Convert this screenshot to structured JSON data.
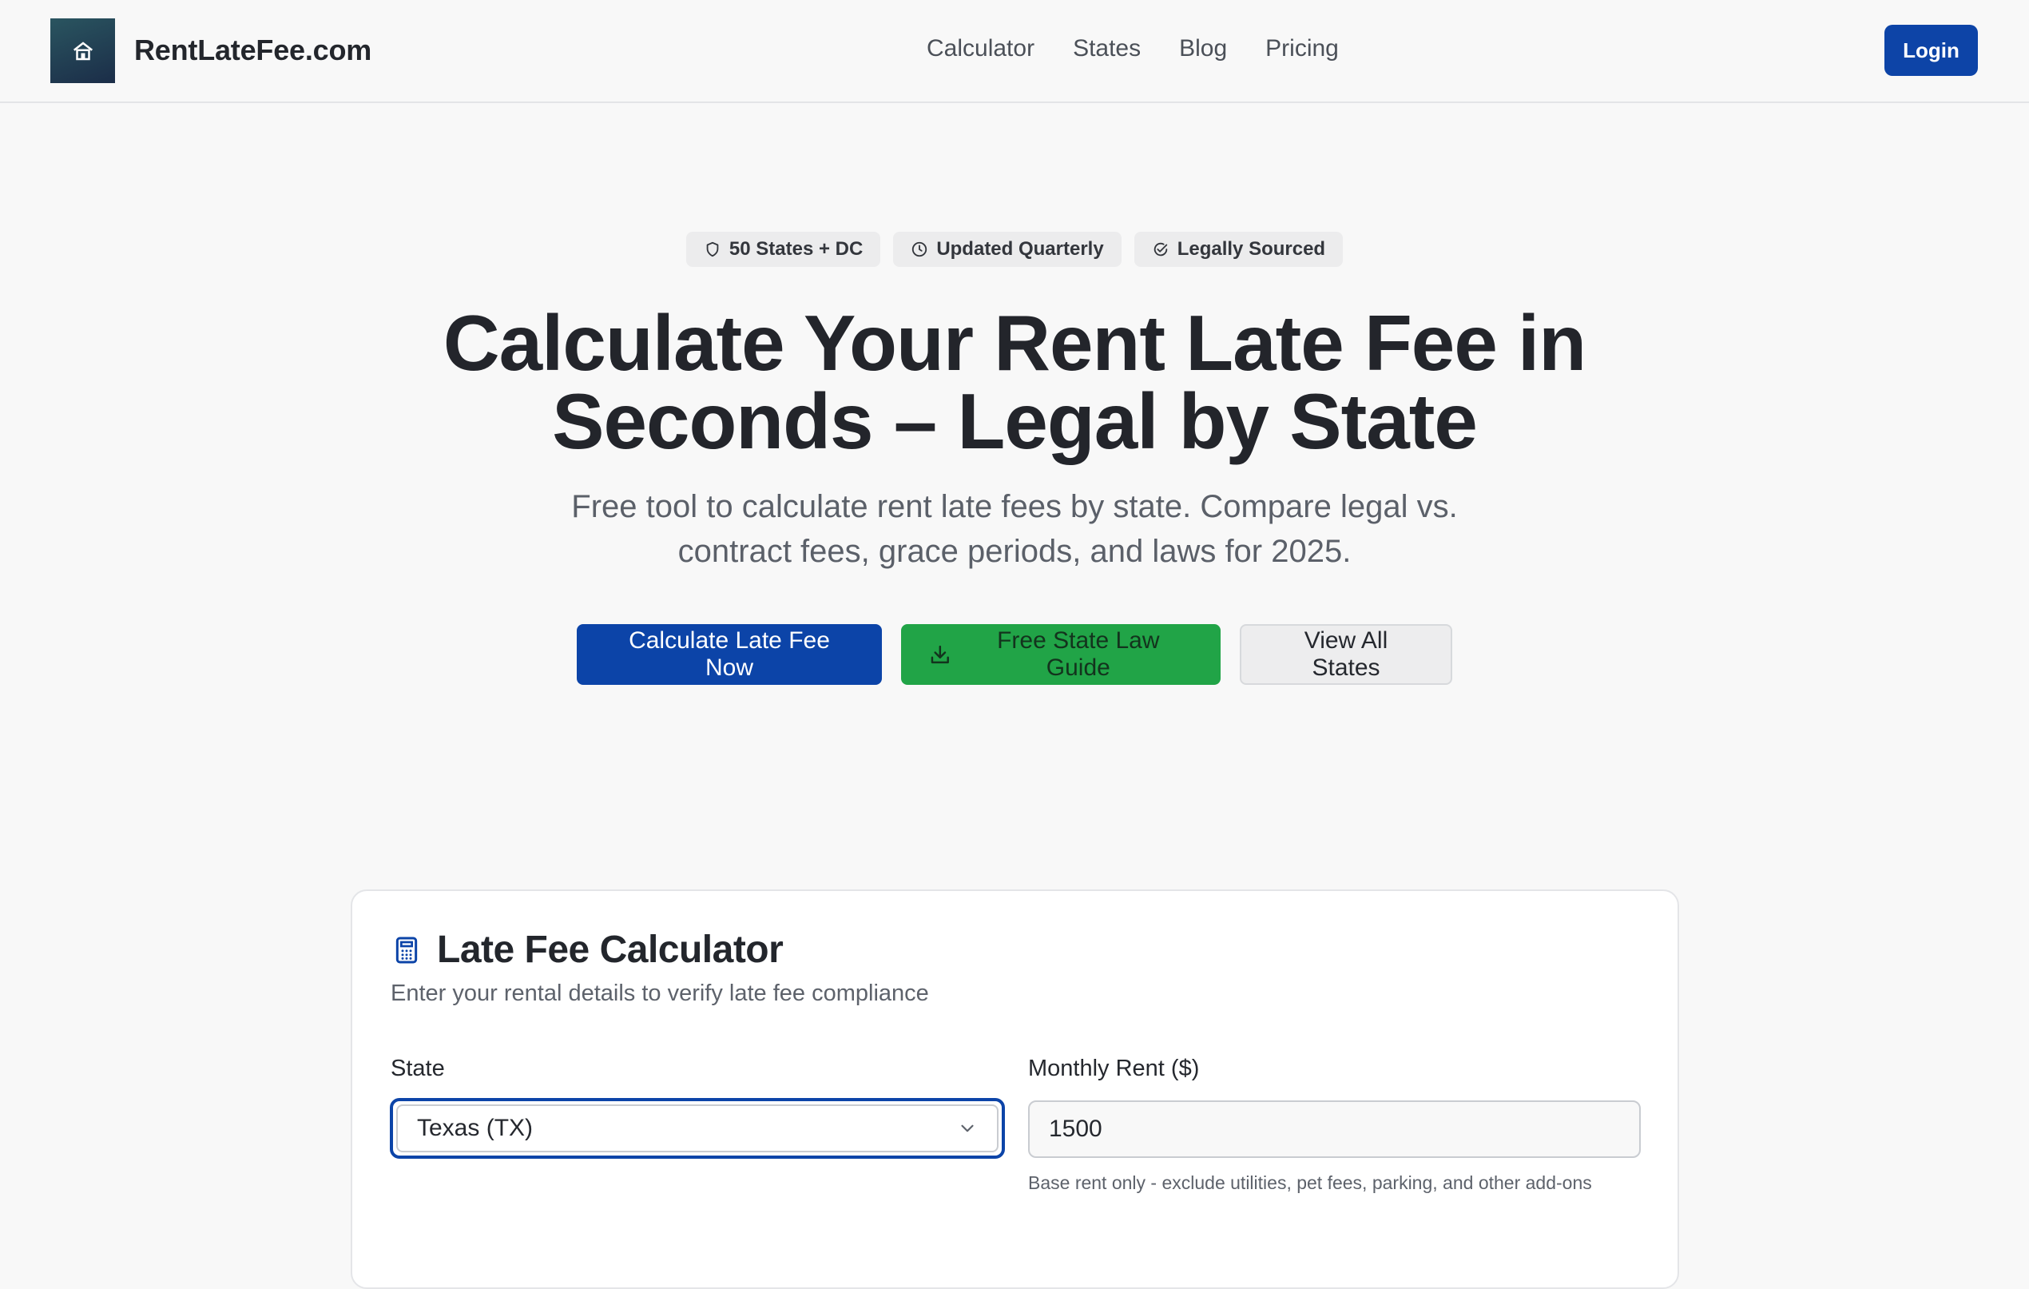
{
  "header": {
    "brand": "RentLateFee.com",
    "nav": [
      "Calculator",
      "States",
      "Blog",
      "Pricing"
    ],
    "login_label": "Login"
  },
  "badges": [
    "50 States + DC",
    "Updated Quarterly",
    "Legally Sourced"
  ],
  "hero": {
    "title_line1": "Calculate Your Rent Late Fee in",
    "title_line2": "Seconds – Legal by State",
    "subtitle_line1": "Free tool to calculate rent late fees by state. Compare legal vs.",
    "subtitle_line2": "contract fees, grace periods, and laws for 2025.",
    "cta_primary": "Calculate Late Fee Now",
    "cta_guide": "Free State Law Guide",
    "cta_states": "View All States"
  },
  "calculator": {
    "title": "Late Fee Calculator",
    "subtitle": "Enter your rental details to verify late fee compliance",
    "state_label": "State",
    "state_value": "Texas (TX)",
    "rent_label": "Monthly Rent ($)",
    "rent_value": "1500",
    "rent_helper": "Base rent only - exclude utilities, pet fees, parking, and other add-ons"
  },
  "colors": {
    "primary": "#0c44a8",
    "green": "#21a447",
    "background": "#f8f8f8"
  }
}
